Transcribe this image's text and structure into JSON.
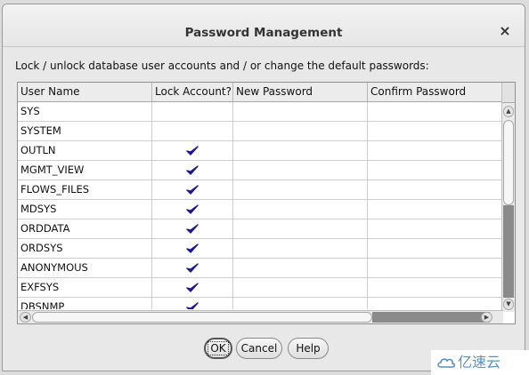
{
  "dialog": {
    "title": "Password Management",
    "close_glyph": "×",
    "instruction": "Lock / unlock database user accounts and / or change the default passwords:"
  },
  "table": {
    "columns": [
      "User Name",
      "Lock Account?",
      "New Password",
      "Confirm Password"
    ],
    "rows": [
      {
        "user": "SYS",
        "locked": false
      },
      {
        "user": "SYSTEM",
        "locked": false
      },
      {
        "user": "OUTLN",
        "locked": true
      },
      {
        "user": "MGMT_VIEW",
        "locked": true
      },
      {
        "user": "FLOWS_FILES",
        "locked": true
      },
      {
        "user": "MDSYS",
        "locked": true
      },
      {
        "user": "ORDDATA",
        "locked": true
      },
      {
        "user": "ORDSYS",
        "locked": true
      },
      {
        "user": "ANONYMOUS",
        "locked": true
      },
      {
        "user": "EXFSYS",
        "locked": true
      },
      {
        "user": "DBSNMP",
        "locked": true
      }
    ],
    "check_color": "#1a1a8c"
  },
  "buttons": {
    "ok": "OK",
    "cancel": "Cancel",
    "help": "Help"
  },
  "watermark": {
    "text": "亿速云"
  }
}
